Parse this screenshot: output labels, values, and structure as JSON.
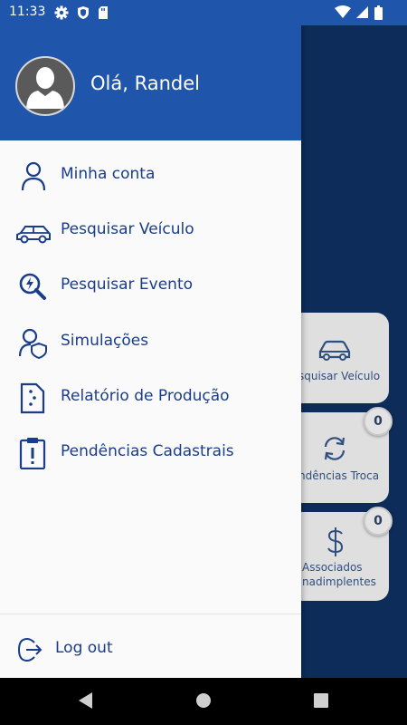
{
  "status_bar": {
    "time": "11:33",
    "left_icons": [
      "gear-icon",
      "shield-icon",
      "sdcard-icon"
    ],
    "right_icons": [
      "wifi-icon",
      "signal-icon",
      "battery-icon"
    ]
  },
  "drawer": {
    "greeting": "Olá, Randel",
    "menu_items": [
      {
        "label": "Minha conta",
        "icon": "person-icon"
      },
      {
        "label": "Pesquisar Veículo",
        "icon": "car-icon"
      },
      {
        "label": "Pesquisar Evento",
        "icon": "search-event-icon"
      },
      {
        "label": "Simulações",
        "icon": "user-shield-icon"
      },
      {
        "label": "Relatório de Produção",
        "icon": "report-icon"
      },
      {
        "label": "Pendências Cadastrais",
        "icon": "clipboard-alert-icon"
      }
    ],
    "logout_label": "Log out"
  },
  "background_cards": [
    {
      "label": "squisar Veículo",
      "icon": "car-icon",
      "badge": null
    },
    {
      "label": "ndências Troca",
      "icon": "refresh-icon",
      "badge": "0"
    },
    {
      "label_line1": "Associados",
      "label_line2": "nadimplentes",
      "icon": "dollar-icon",
      "badge": "0"
    }
  ],
  "colors": {
    "primary": "#1f55aa",
    "menu_text": "#1a3d8a",
    "background_dark": "#0d2c59",
    "card": "#dfdfdf"
  },
  "nav_bar": [
    "back-icon",
    "home-icon",
    "recents-icon"
  ]
}
